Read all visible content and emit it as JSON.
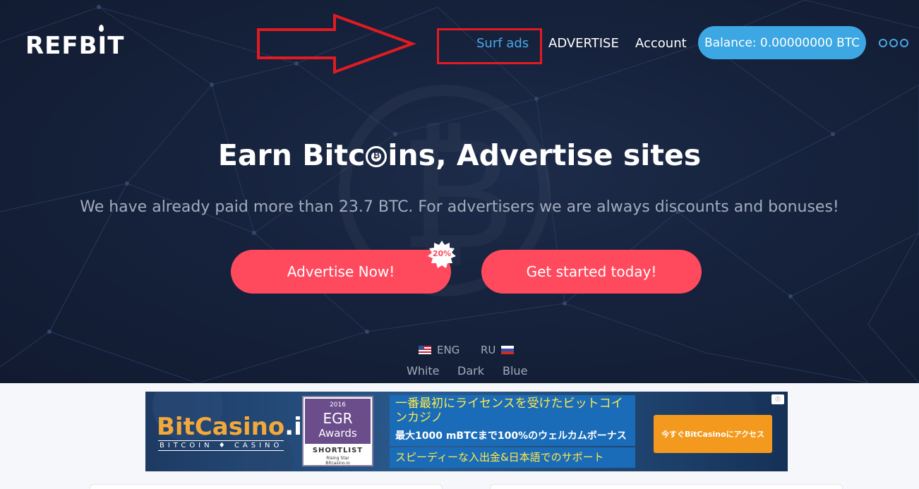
{
  "brand": {
    "logo_text": "REFBIT"
  },
  "nav": {
    "surf_ads": "Surf ads",
    "advertise": "ADVERTISE",
    "account": "Account",
    "balance": "Balance: 0.00000000 BTC",
    "more_icon": "three-dots-icon"
  },
  "hero": {
    "headline_before": "Earn Bitc",
    "headline_after": "ins, Advertise sites",
    "subline": "We have already paid more than 23.7 BTC. For advertisers we are always discounts and bonuses!",
    "advertise_button": "Advertise Now!",
    "promo_badge": "20%",
    "start_button": "Get started today!"
  },
  "language": {
    "eng": "ENG",
    "ru": "RU"
  },
  "themes": {
    "white": "White",
    "dark": "Dark",
    "blue": "Blue"
  },
  "annotation": {
    "arrow_color": "#e21b22"
  },
  "ad_banner": {
    "brand": "BitCasino",
    "brand_suffix": ".io",
    "brand_sub": "BITCOIN ♦ CASINO",
    "award_year": "2016",
    "award_title": "EGR",
    "award_name": "Awards",
    "award_shortlist": "SHORTLIST",
    "award_category": "Rising Star",
    "award_site": "Bitcasino.io",
    "jp_line1": "一番最初にライセンスを受けたビットコインカジノ",
    "jp_line2": "最大1000 mBTCまで100%のウェルカムボーナス",
    "jp_line3": "スピーディーな入出金&日本語でのサポート",
    "cta": "今すぐBitCasinoにアクセス",
    "adchoice": "ⓘ"
  },
  "colors": {
    "hero_bg": "#16223c",
    "accent_blue": "#3ca7e3",
    "cta_red": "#ff4a5e",
    "muted_text": "#a3acbd"
  }
}
